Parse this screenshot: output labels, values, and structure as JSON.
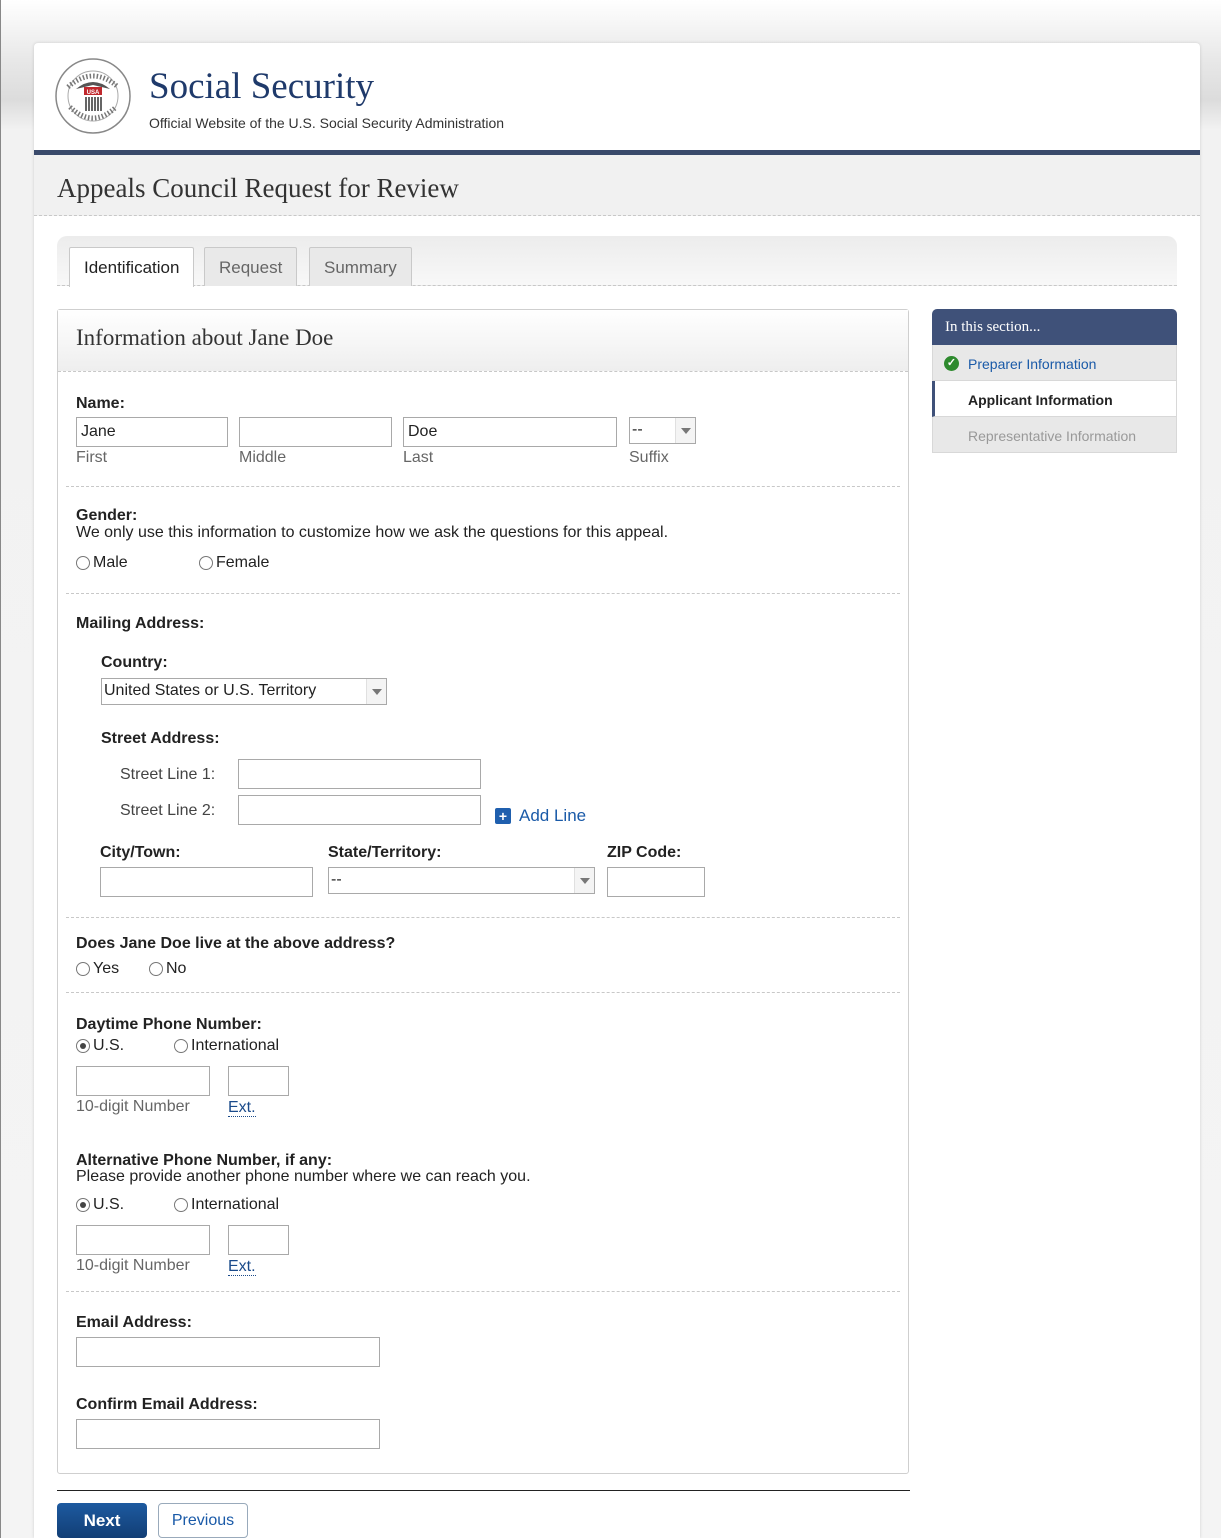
{
  "header": {
    "site_title": "Social Security",
    "tagline": "Official Website of the U.S. Social Security Administration",
    "seal_ring_text": "SOCIAL SECURITY ADMINISTRATION",
    "seal_center_text": "USA"
  },
  "page_title": "Appeals Council Request for Review",
  "tabs": [
    {
      "label": "Identification",
      "active": true
    },
    {
      "label": "Request",
      "active": false
    },
    {
      "label": "Summary",
      "active": false
    }
  ],
  "form": {
    "title": "Information about Jane Doe",
    "name": {
      "label": "Name:",
      "first_value": "Jane",
      "first_caption": "First",
      "middle_value": "",
      "middle_caption": "Middle",
      "last_value": "Doe",
      "last_caption": "Last",
      "suffix_value": "--",
      "suffix_caption": "Suffix"
    },
    "gender": {
      "label": "Gender:",
      "help": "We only use this information to customize how we ask the questions for this appeal.",
      "options": [
        "Male",
        "Female"
      ]
    },
    "mailing": {
      "label": "Mailing Address:",
      "country_label": "Country:",
      "country_value": "United States or U.S. Territory",
      "street_label": "Street Address:",
      "street1_label": "Street Line 1:",
      "street2_label": "Street Line 2:",
      "add_line": "Add Line",
      "city_label": "City/Town:",
      "state_label": "State/Territory:",
      "state_value": "--",
      "zip_label": "ZIP Code:"
    },
    "live_at": {
      "label": "Does Jane Doe live at the above address?",
      "options": [
        "Yes",
        "No"
      ]
    },
    "daytime_phone": {
      "label": "Daytime Phone Number:",
      "options": [
        "U.S.",
        "International"
      ],
      "selected": "U.S.",
      "number_caption": "10-digit Number",
      "ext_caption": "Ext."
    },
    "alt_phone": {
      "label": "Alternative Phone Number, if any:",
      "help": "Please provide another phone number where we can reach you.",
      "options": [
        "U.S.",
        "International"
      ],
      "selected": "U.S.",
      "number_caption": "10-digit Number",
      "ext_caption": "Ext."
    },
    "email_label": "Email Address:",
    "confirm_email_label": "Confirm Email Address:"
  },
  "sidebar": {
    "heading": "In this section...",
    "items": [
      {
        "label": "Preparer Information",
        "state": "done"
      },
      {
        "label": "Applicant Information",
        "state": "current"
      },
      {
        "label": "Representative Information",
        "state": "disabled"
      }
    ]
  },
  "buttons": {
    "next": "Next",
    "previous": "Previous"
  },
  "colors": {
    "brand_navy": "#3a4a6b",
    "link_blue": "#1a5aa8",
    "primary_button": "#1d5aa0",
    "success_green": "#2e8a2e"
  }
}
